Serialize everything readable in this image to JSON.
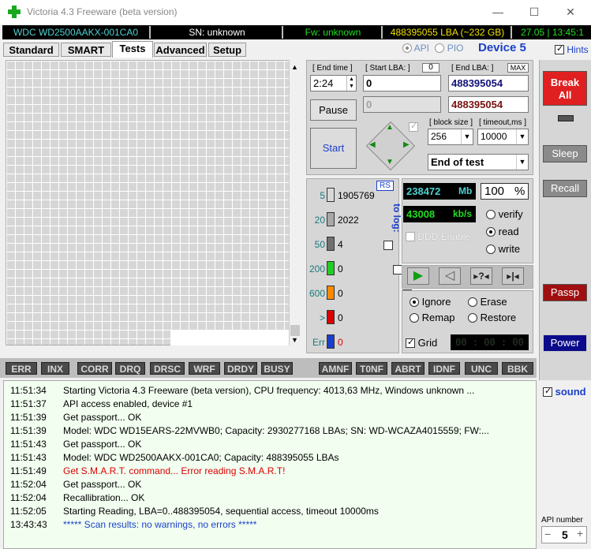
{
  "window": {
    "title": "Victoria 4.3 Freeware (beta version)",
    "minimize": "—",
    "maximize": "☐",
    "close": "✕"
  },
  "infobar": {
    "model": "WDC WD2500AAKX-001CA0",
    "serial": "SN: unknown",
    "firmware": "Fw: unknown",
    "capacity": "488395055 LBA (~232 GB)",
    "datetime": "27.05 | 13:45:1"
  },
  "tabs": [
    {
      "label": "Standard"
    },
    {
      "label": "SMART"
    },
    {
      "label": "Tests"
    },
    {
      "label": "Advanced"
    },
    {
      "label": "Setup"
    }
  ],
  "mode": {
    "api": "API",
    "pio": "PIO",
    "device": "Device 5",
    "hints": "Hints"
  },
  "test": {
    "end_time_label": "[ End time ]",
    "end_time": "2:24",
    "start_lba_label": "[ Start LBA: ]",
    "start_lba_zero": "0",
    "start_lba": "0",
    "end_lba_label": "[ End LBA: ]",
    "max_label": "MAX",
    "end_lba": "488395054",
    "current_lba": "0",
    "current_end_lba": "488395054",
    "pause_label": "Pause",
    "start_label": "Start",
    "block_size_label": "[ block size ]",
    "block_size": "256",
    "timeout_label": "[ timeout,ms ]",
    "timeout": "10000",
    "end_action": "End of test"
  },
  "stats": {
    "rs_label": "RS",
    "to_log_label": "to log:",
    "rows": [
      {
        "ms": "5",
        "value": "1905769",
        "color": "#d9d9d9"
      },
      {
        "ms": "20",
        "value": "2022",
        "color": "#a8a8a8"
      },
      {
        "ms": "50",
        "value": "4",
        "color": "#707070"
      },
      {
        "ms": "200",
        "value": "0",
        "color": "#22cc22"
      },
      {
        "ms": "600",
        "value": "0",
        "color": "#ff8800"
      },
      {
        "ms": ">",
        "value": "0",
        "color": "#dd0000"
      },
      {
        "ms": "Err",
        "value": "0",
        "color": "#1a3fc9"
      }
    ]
  },
  "speed": {
    "mb": "238472",
    "mb_unit": "Mb",
    "percent": "100",
    "percent_unit": "%",
    "kbs": "43008",
    "kbs_unit": "kb/s",
    "ddd_label": "DDD Enable",
    "verify": "verify",
    "read": "read",
    "write": "write"
  },
  "actions": {
    "ignore": "Ignore",
    "erase": "Erase",
    "remap": "Remap",
    "restore": "Restore",
    "grid": "Grid",
    "timer": "00 : 00 : 00"
  },
  "flags": [
    "ERR",
    "INX",
    "CORR",
    "DRQ",
    "DRSC",
    "WRF",
    "DRDY",
    "BUSY",
    "AMNF",
    "T0NF",
    "ABRT",
    "IDNF",
    "UNC",
    "BBK"
  ],
  "side": {
    "break_all": "Break All",
    "sleep": "Sleep",
    "recall": "Recall",
    "passp": "Passp",
    "power": "Power",
    "sound": "sound",
    "api_number_label": "API number",
    "api_number": "5"
  },
  "log": [
    {
      "time": "11:51:34",
      "msg": "Starting Victoria 4.3 Freeware (beta version), CPU frequency: 4013,63 MHz, Windows unknown ...",
      "color": "#000000"
    },
    {
      "time": "11:51:37",
      "msg": "API access enabled, device #1",
      "color": "#000000"
    },
    {
      "time": "11:51:39",
      "msg": "Get passport... OK",
      "color": "#000000"
    },
    {
      "time": "11:51:39",
      "msg": "Model: WDC WD15EARS-22MVWB0; Capacity: 2930277168 LBAs; SN: WD-WCAZA4015559; FW:...",
      "color": "#000000"
    },
    {
      "time": "11:51:43",
      "msg": "Get passport... OK",
      "color": "#000000"
    },
    {
      "time": "11:51:43",
      "msg": "Model: WDC WD2500AAKX-001CA0; Capacity: 488395055 LBAs",
      "color": "#000000"
    },
    {
      "time": "11:51:49",
      "msg": "Get S.M.A.R.T. command... Error reading S.M.A.R.T!",
      "color": "#dd0000"
    },
    {
      "time": "11:52:04",
      "msg": "Get passport... OK",
      "color": "#000000"
    },
    {
      "time": "11:52:04",
      "msg": "Recallibration... OK",
      "color": "#000000"
    },
    {
      "time": "11:52:05",
      "msg": "Starting Reading, LBA=0..488395054, sequential access, timeout 10000ms",
      "color": "#000000"
    },
    {
      "time": "13:43:43",
      "msg": "***** Scan results: no warnings, no errors *****",
      "color": "#1a3fc9"
    }
  ]
}
